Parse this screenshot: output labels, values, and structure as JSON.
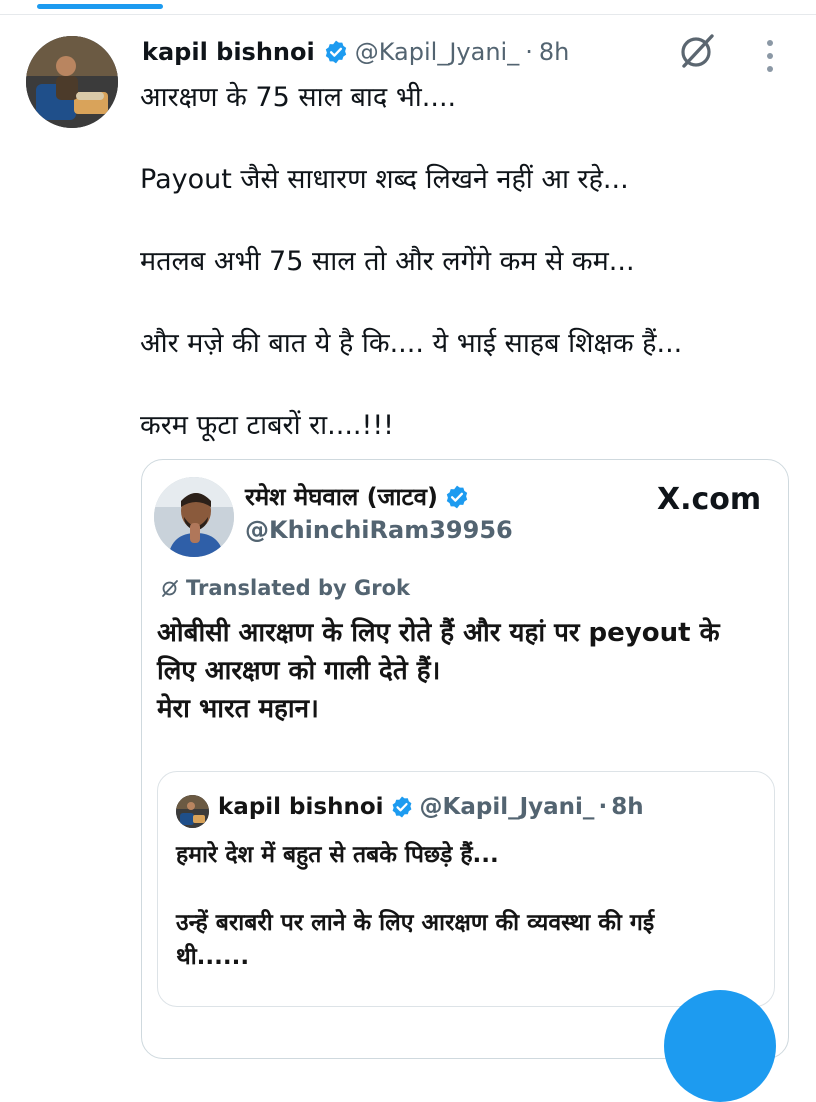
{
  "tweet": {
    "author_name": "kapil bishnoi",
    "author_handle": "@Kapil_Jyani_",
    "separator": "·",
    "time": "8h",
    "lines": [
      "आरक्षण के 75 साल बाद भी....",
      "Payout जैसे साधारण शब्द लिखने नहीं आ रहे...",
      "मतलब अभी 75 साल तो और लगेंगे कम से कम...",
      "और मज़े की बात ये है कि.... ये भाई साहब शिक्षक हैं...",
      "करम फूटा टाबरों रा....!!!"
    ]
  },
  "quoted_post": {
    "author_name": "रमेश मेघवाल (जाटव)",
    "author_handle": "@KhinchiRam39956",
    "source": "X.com",
    "translated_label": "Translated by Grok",
    "lines": [
      "ओबीसी आरक्षण के लिए रोते हैं और यहां पर peyout के",
      "लिए आरक्षण को गाली देते हैं।",
      "मेरा भारत महान।"
    ]
  },
  "nested_quote": {
    "author_name": "kapil bishnoi",
    "author_handle": "@Kapil_Jyani_",
    "separator": "·",
    "time": "8h",
    "lines": [
      "हमारे देश में बहुत से तबके पिछड़े हैं...",
      "उन्हें बराबरी पर लाने के लिए आरक्षण की व्यवस्था की गई\nथी......"
    ]
  },
  "icons": {
    "verified": "verified-badge-icon",
    "grok": "grok-icon",
    "more": "more-options-icon",
    "compose": "compose-fab"
  },
  "colors": {
    "accent": "#1d9bf0",
    "text": "#0f1419",
    "muted": "#536471",
    "border": "#cfd9de"
  }
}
